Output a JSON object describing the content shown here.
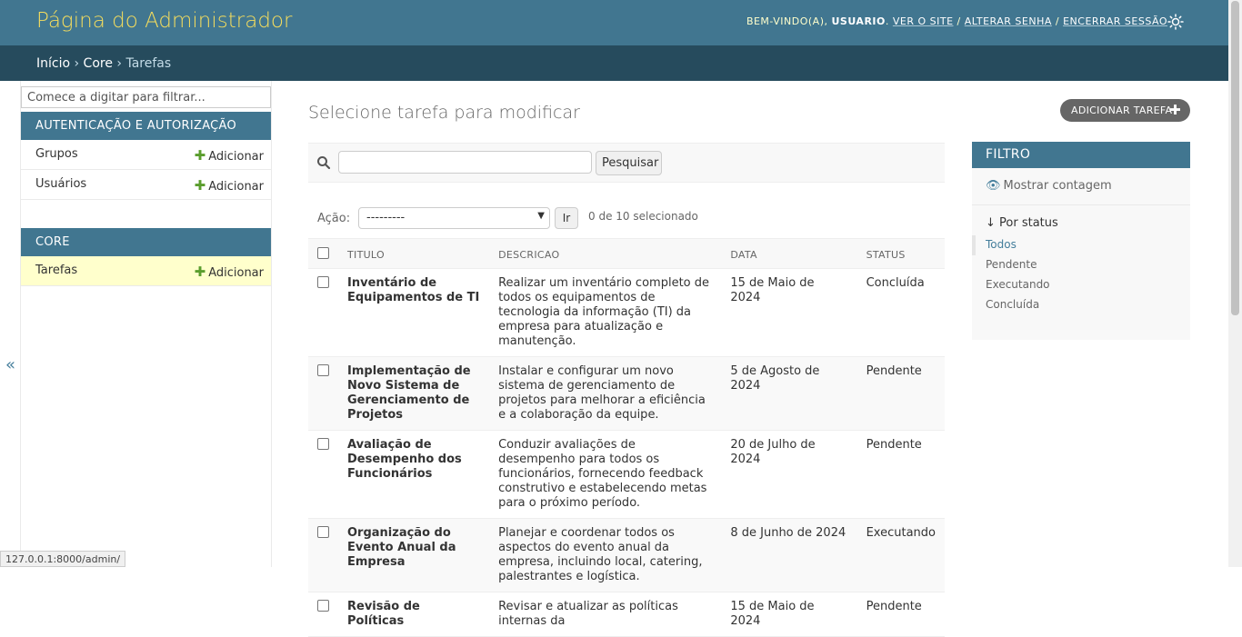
{
  "header": {
    "site_name": "Página do Administrador",
    "welcome": "Bem-vindo(a), ",
    "username": "USUARIO",
    "view_site": "Ver o site",
    "change_password": "Alterar senha",
    "logout": "Encerrar sessão",
    "separator": " / "
  },
  "breadcrumbs": {
    "home": "Início",
    "app": "Core",
    "current": "Tarefas",
    "sep": " › "
  },
  "sidebar": {
    "filter_placeholder": "Comece a digitar para filtrar...",
    "collapse_glyph": "«",
    "modules": [
      {
        "caption": "Autenticação e Autorização",
        "models": [
          {
            "label": "Grupos",
            "add": "Adicionar"
          },
          {
            "label": "Usuários",
            "add": "Adicionar"
          }
        ]
      },
      {
        "caption": "Core",
        "models": [
          {
            "label": "Tarefas",
            "add": "Adicionar"
          }
        ]
      }
    ]
  },
  "main": {
    "title": "Selecione tarefa para modificar",
    "add_button": "Adicionar tarefa",
    "search_button": "Pesquisar",
    "search_value": "",
    "action_label": "Ação:",
    "action_selected": "---------",
    "go_button": "Ir",
    "action_counter": "0 de 10 selecionado"
  },
  "table": {
    "columns": [
      "Titulo",
      "Descricao",
      "Data",
      "Status"
    ],
    "rows": [
      {
        "titulo": "Inventário de Equipamentos de TI",
        "descricao": "Realizar um inventário completo de todos os equipamentos de tecnologia da informação (TI) da empresa para atualização e manutenção.",
        "data": "15 de Maio de 2024",
        "status": "Concluída"
      },
      {
        "titulo": "Implementação de Novo Sistema de Gerenciamento de Projetos",
        "descricao": "Instalar e configurar um novo sistema de gerenciamento de projetos para melhorar a eficiência e a colaboração da equipe.",
        "data": "5 de Agosto de 2024",
        "status": "Pendente"
      },
      {
        "titulo": "Avaliação de Desempenho dos Funcionários",
        "descricao": "Conduzir avaliações de desempenho para todos os funcionários, fornecendo feedback construtivo e estabelecendo metas para o próximo período.",
        "data": "20 de Julho de 2024",
        "status": "Pendente"
      },
      {
        "titulo": "Organização do Evento Anual da Empresa",
        "descricao": "Planejar e coordenar todos os aspectos do evento anual da empresa, incluindo local, catering, palestrantes e logística.",
        "data": "8 de Junho de 2024",
        "status": "Executando"
      },
      {
        "titulo": "Revisão de Políticas",
        "descricao": "Revisar e atualizar as políticas internas da",
        "data": "15 de Maio de 2024",
        "status": "Pendente"
      }
    ]
  },
  "filter": {
    "caption": "Filtro",
    "show_counts": "Mostrar contagem",
    "by_status": "↓ Por status",
    "options": [
      "Todos",
      "Pendente",
      "Executando",
      "Concluída"
    ],
    "selected_option": "Todos"
  },
  "status_bar": {
    "url": "127.0.0.1:8000/admin/"
  },
  "colors": {
    "header_bg": "#417690",
    "breadcrumbs_bg": "#264b5d",
    "site_name": "#f5dd5d",
    "add_green": "#5a9d2d",
    "current_row": "#ffffcc"
  }
}
